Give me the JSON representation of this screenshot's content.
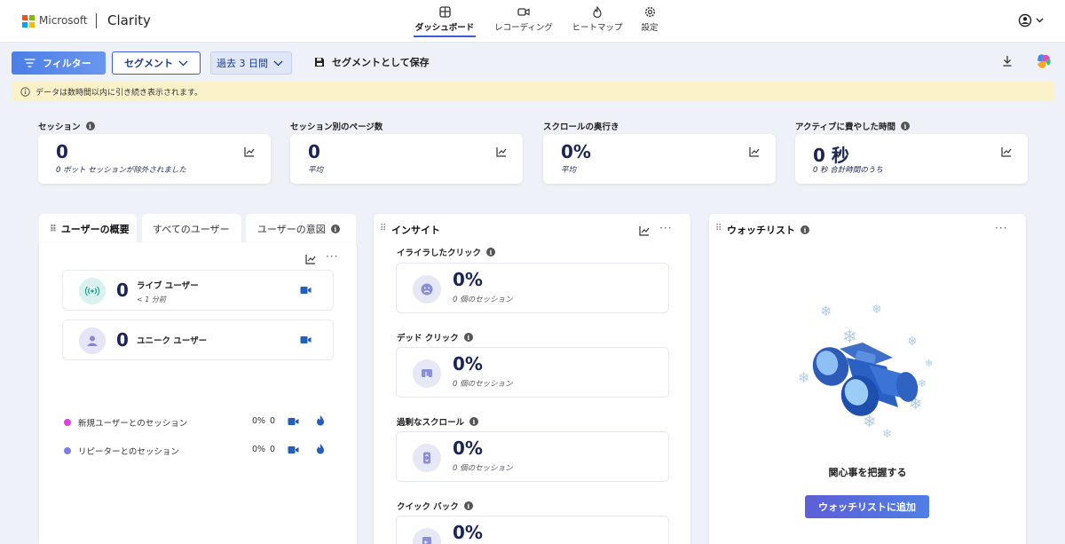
{
  "brand": {
    "company": "Microsoft",
    "app": "Clarity",
    "logo_colors": [
      "#f25022",
      "#7fba00",
      "#00a4ef",
      "#ffb900"
    ]
  },
  "nav": [
    {
      "label": "ダッシュボード",
      "icon": "dashboard-icon",
      "active": true
    },
    {
      "label": "レコーディング",
      "icon": "video-icon"
    },
    {
      "label": "ヒートマップ",
      "icon": "flame-icon"
    },
    {
      "label": "設定",
      "icon": "gear-icon"
    }
  ],
  "toolbar": {
    "filter_label": "フィルター",
    "segment_label": "セグメント",
    "range_label": "過去 3 日間",
    "save_label": "セグメントとして保存"
  },
  "banner": {
    "text": "データは数時間以内に引き続き表示されます。"
  },
  "stats": [
    {
      "label": "セッション",
      "value": "0",
      "sub": "0 ボット セッションが除外されました",
      "has_info": true
    },
    {
      "label": "セッション別のページ数",
      "value": "0",
      "sub": "平均",
      "has_info": false
    },
    {
      "label": "スクロールの奥行き",
      "value": "0%",
      "sub": "平均",
      "has_info": false
    },
    {
      "label": "アクティブに費やした時間",
      "value": "0 秒",
      "sub": "0 秒 合計時間のうち",
      "has_info": true
    }
  ],
  "users_panel": {
    "tabs": [
      "ユーザーの概要",
      "すべてのユーザー",
      "ユーザーの意図"
    ],
    "live": {
      "value": "0",
      "label": "ライブ ユーザー",
      "sub": "< 1 分前"
    },
    "unique": {
      "value": "0",
      "label": "ユニーク ユーザー"
    },
    "rows": [
      {
        "label": "新規ユーザーとのセッション",
        "pct": "0%",
        "count": "0",
        "color": "#e040e0"
      },
      {
        "label": "リピーターとのセッション",
        "pct": "0%",
        "count": "0",
        "color": "#7b7fe8"
      }
    ]
  },
  "insights": {
    "title": "インサイト",
    "items": [
      {
        "label": "イライラしたクリック",
        "value": "0%",
        "sub": "0 個のセッション",
        "icon": "frown-face-icon"
      },
      {
        "label": "デッド クリック",
        "value": "0%",
        "sub": "0 個のセッション",
        "icon": "dead-click-icon"
      },
      {
        "label": "過剰なスクロール",
        "value": "0%",
        "sub": "0 個のセッション",
        "icon": "scroll-icon"
      },
      {
        "label": "クイック バック",
        "value": "0%",
        "sub": "",
        "icon": "back-icon"
      }
    ]
  },
  "watchlist": {
    "title": "ウォッチリスト",
    "caption": "関心事を把握する",
    "add_label": "ウォッチリストに追加"
  },
  "colors": {
    "accent": "#3b5bdb",
    "banner": "#fcf2c9",
    "background": "#eef1f8"
  }
}
